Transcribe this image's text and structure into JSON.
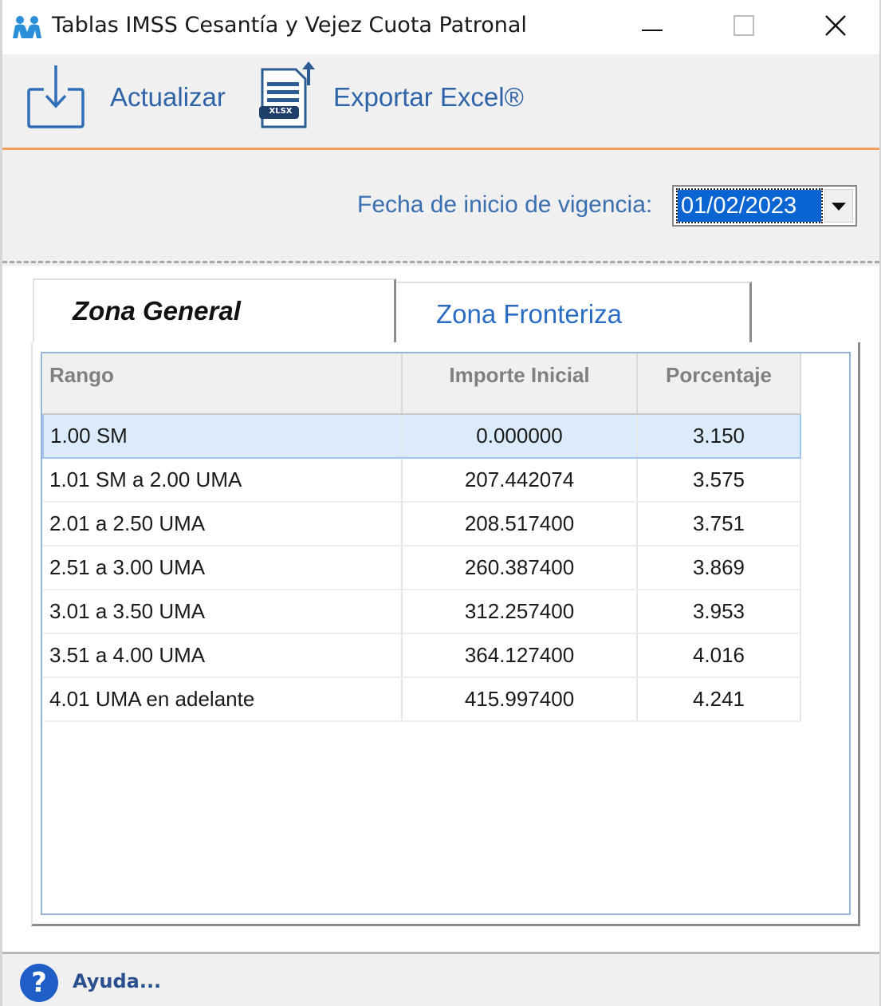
{
  "window": {
    "title": "Tablas IMSS Cesantía y Vejez Cuota Patronal",
    "controls": {
      "minimize": "minimize-icon",
      "maximize": "maximize-icon",
      "close": "close-icon"
    }
  },
  "toolbar": {
    "actualizar": {
      "label": "Actualizar",
      "icon": "download-tray-icon"
    },
    "exportar": {
      "label": "Exportar Excel®",
      "icon": "xlsx-export-icon",
      "icon_badge": "XLSX"
    }
  },
  "filter": {
    "label": "Fecha de inicio de vigencia:",
    "selected_date": "01/02/2023"
  },
  "tabs": [
    {
      "label": "Zona General",
      "active": true
    },
    {
      "label": "Zona Fronteriza",
      "active": false
    }
  ],
  "table": {
    "columns": [
      "Rango",
      "Importe Inicial",
      "Porcentaje"
    ],
    "rows": [
      {
        "rango": "1.00 SM",
        "importe": "0.000000",
        "porcentaje": "3.150"
      },
      {
        "rango": "1.01 SM a 2.00 UMA",
        "importe": "207.442074",
        "porcentaje": "3.575"
      },
      {
        "rango": "2.01 a 2.50 UMA",
        "importe": "208.517400",
        "porcentaje": "3.751"
      },
      {
        "rango": "2.51 a 3.00 UMA",
        "importe": "260.387400",
        "porcentaje": "3.869"
      },
      {
        "rango": "3.01 a 3.50 UMA",
        "importe": "312.257400",
        "porcentaje": "3.953"
      },
      {
        "rango": "3.51 a 4.00 UMA",
        "importe": "364.127400",
        "porcentaje": "4.016"
      },
      {
        "rango": "4.01 UMA en adelante",
        "importe": "415.997400",
        "porcentaje": "4.241"
      }
    ],
    "selected_row": 0
  },
  "footer": {
    "help_label": "Ayuda...",
    "help_icon_glyph": "?"
  },
  "colors": {
    "accent_orange": "#f5a05a",
    "link_blue": "#2f63a8",
    "selection": "#0a64d2"
  }
}
